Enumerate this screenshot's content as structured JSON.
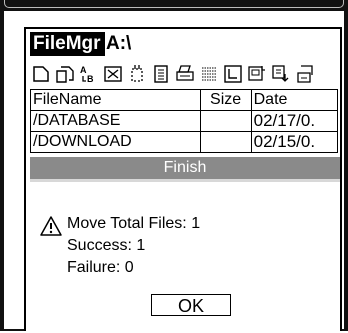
{
  "app": {
    "title": "FileMgr",
    "drive": "A:\\"
  },
  "toolbar": {
    "icons": [
      "new-file-icon",
      "copy-icon",
      "rename-icon",
      "delete-icon",
      "cut-icon",
      "properties-icon",
      "print-icon",
      "list-view-icon",
      "up-folder-icon",
      "details-icon",
      "sort-icon",
      "send-icon"
    ]
  },
  "table": {
    "headers": {
      "name": "FileName",
      "size": "Size",
      "date": "Date"
    },
    "rows": [
      {
        "name": "/DATABASE",
        "size": "",
        "date": "02/17/0."
      },
      {
        "name": "/DOWNLOAD",
        "size": "",
        "date": "02/15/0."
      }
    ]
  },
  "dialog": {
    "title": "Finish",
    "line1": "Move Total Files: 1",
    "line2": "Success: 1",
    "line3": "Failure: 0",
    "ok_label": "OK",
    "icon": "warning-icon"
  }
}
